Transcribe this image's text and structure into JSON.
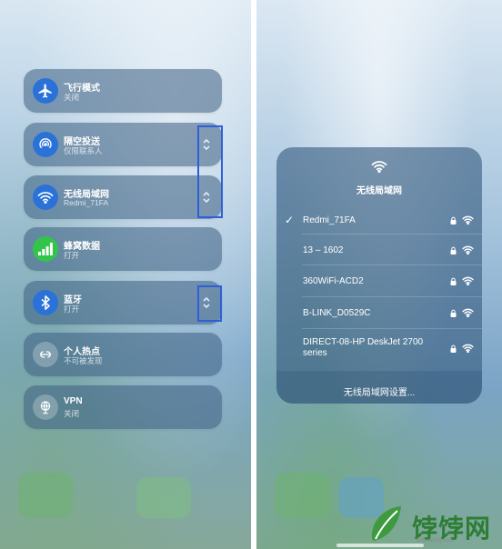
{
  "left": {
    "tiles": [
      {
        "icon": "airplane-icon",
        "title": "飞行模式",
        "subtitle": "关闭",
        "icon_bg": "#2a72d8"
      },
      {
        "icon": "airdrop-icon",
        "title": "隔空投送",
        "subtitle": "仅限联系人",
        "icon_bg": "#2a72d8"
      },
      {
        "icon": "wifi-icon",
        "title": "无线局域网",
        "subtitle": "Redmi_71FA",
        "icon_bg": "#2a72d8"
      },
      {
        "icon": "cellular-icon",
        "title": "蜂窝数据",
        "subtitle": "打开",
        "icon_bg": "#33c44b"
      },
      {
        "icon": "bluetooth-icon",
        "title": "蓝牙",
        "subtitle": "打开",
        "icon_bg": "#2a72d8"
      },
      {
        "icon": "hotspot-icon",
        "title": "个人热点",
        "subtitle": "不可被发现",
        "icon_bg": "rgba(255,255,255,0.25)"
      },
      {
        "icon": "vpn-icon",
        "title": "VPN",
        "subtitle": "关闭",
        "icon_bg": "rgba(255,255,255,0.25)"
      }
    ],
    "highlight_color": "#2f5fd8"
  },
  "right": {
    "title": "无线局域网",
    "networks": [
      {
        "name": "Redmi_71FA",
        "connected": true
      },
      {
        "name": "13 – 1602",
        "connected": false
      },
      {
        "name": "360WiFi-ACD2",
        "connected": false
      },
      {
        "name": "B-LINK_D0529C",
        "connected": false
      },
      {
        "name": "DIRECT-08-HP DeskJet 2700 series",
        "connected": false
      }
    ],
    "check_glyph": "✓",
    "settings_label": "无线局域网设置..."
  },
  "watermark": {
    "text": "饽饽网",
    "sub": "bobowang.com",
    "color": "#2d7d33"
  }
}
